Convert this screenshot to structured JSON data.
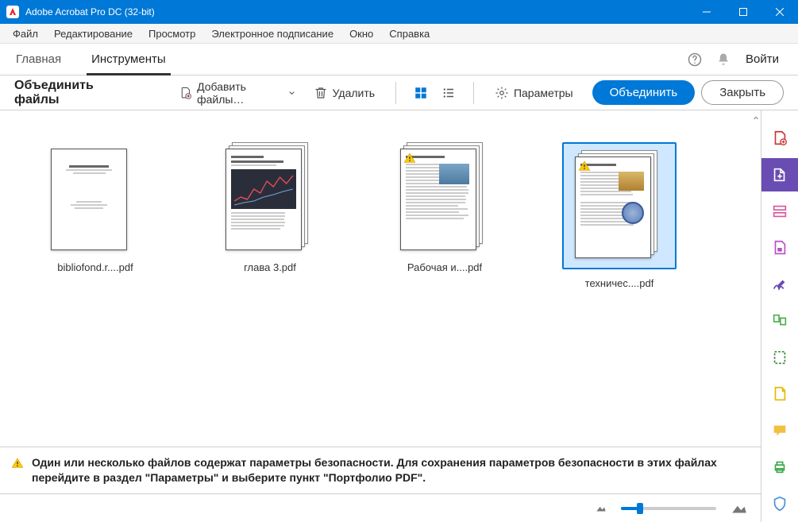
{
  "window": {
    "title": "Adobe Acrobat Pro DC (32-bit)"
  },
  "menu": {
    "items": [
      "Файл",
      "Редактирование",
      "Просмотр",
      "Электронное подписание",
      "Окно",
      "Справка"
    ]
  },
  "tabs": {
    "items": [
      "Главная",
      "Инструменты"
    ],
    "active": 1,
    "login": "Войти"
  },
  "toolbar": {
    "title": "Объединить файлы",
    "add": "Добавить файлы…",
    "delete": "Удалить",
    "params": "Параметры",
    "combine": "Объединить",
    "close": "Закрыть"
  },
  "files": [
    {
      "name": "bibliofond.r....pdf",
      "multi": false,
      "warn": false,
      "kind": "text"
    },
    {
      "name": "глава 3.pdf",
      "multi": true,
      "warn": false,
      "kind": "chart"
    },
    {
      "name": "Рабочая и....pdf",
      "multi": true,
      "warn": true,
      "kind": "photo"
    },
    {
      "name": "техничес....pdf",
      "multi": true,
      "warn": true,
      "kind": "seal",
      "selected": true
    }
  ],
  "warning": "Один или несколько файлов содержат параметры безопасности. Для сохранения параметров безопасности в этих файлах перейдите в раздел \"Параметры\" и выберите пункт \"Портфолио PDF\".",
  "sidetools": [
    "create-pdf",
    "export-pdf",
    "edit-pdf",
    "organize-pdf",
    "sign",
    "redact",
    "protect",
    "comment",
    "print",
    "shield"
  ]
}
